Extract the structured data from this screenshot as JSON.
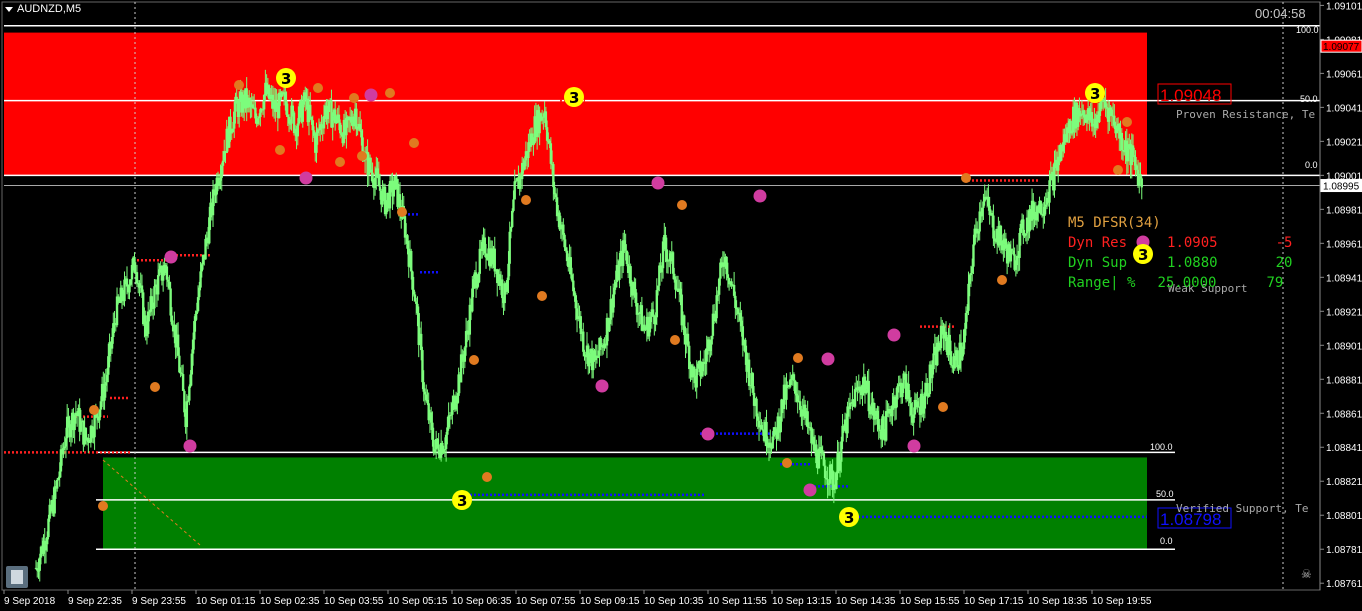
{
  "symbol": "AUDNZD,M5",
  "timer": "00:04:58",
  "colors": {
    "background": "#000000",
    "candle": "#7CFC7C",
    "resistance_zone": "#FF0000",
    "support_zone": "#008000",
    "bid_line": "#C0C0C0",
    "resistance_label": "#FF0000",
    "support_label": "#0000FF",
    "panel_title": "#E0A040",
    "panel_res": "#FF2020",
    "panel_sup": "#20D020",
    "fractal_orange": "#E07A20",
    "fractal_magenta": "#D03CA0",
    "fractal_big": "#FFFF00",
    "dot_red": "#FF2020",
    "dot_blue": "#1010FF"
  },
  "icons": [
    "calculator-icon",
    "skull-icon",
    "triangle-down-icon"
  ],
  "chart_data": {
    "type": "candlestick",
    "ylim": [
      1.08757,
      1.09103
    ],
    "y_ticks": [
      "1.09101",
      "1.09081",
      "1.09061",
      "1.09041",
      "1.09021",
      "1.09001",
      "1.08981",
      "1.08961",
      "1.08941",
      "1.08921",
      "1.08901",
      "1.08881",
      "1.08861",
      "1.08841",
      "1.08821",
      "1.08801",
      "1.08781",
      "1.08761"
    ],
    "x_ticks": [
      "9 Sep 2018",
      "9 Sep 22:35",
      "9 Sep 23:55",
      "10 Sep 01:15",
      "10 Sep 02:35",
      "10 Sep 03:55",
      "10 Sep 05:15",
      "10 Sep 06:35",
      "10 Sep 07:55",
      "10 Sep 09:15",
      "10 Sep 10:35",
      "10 Sep 11:55",
      "10 Sep 13:15",
      "10 Sep 14:35",
      "10 Sep 15:55",
      "10 Sep 17:15",
      "10 Sep 18:35",
      "10 Sep 19:55"
    ],
    "series_close": [
      1.0877,
      1.0879,
      1.08815,
      1.0885,
      1.08862,
      1.08845,
      1.08858,
      1.0888,
      1.0892,
      1.08935,
      1.0895,
      1.0891,
      1.08935,
      1.08948,
      1.08905,
      1.0886,
      1.0892,
      1.0896,
      1.08995,
      1.0902,
      1.0904,
      1.09045,
      1.09035,
      1.0905,
      1.0904,
      1.09045,
      1.0903,
      1.09045,
      1.0902,
      1.0904,
      1.09035,
      1.09025,
      1.0904,
      1.0901,
      1.09,
      1.08985,
      1.08995,
      1.0897,
      1.0893,
      1.0887,
      1.0884,
      1.08845,
      1.0887,
      1.089,
      1.0894,
      1.0896,
      1.0895,
      1.0893,
      1.0899,
      1.0901,
      1.0903,
      1.0904,
      1.0899,
      1.0896,
      1.0893,
      1.089,
      1.0889,
      1.08905,
      1.08935,
      1.0896,
      1.0893,
      1.0891,
      1.0892,
      1.0896,
      1.08945,
      1.0891,
      1.0888,
      1.0889,
      1.0892,
      1.08955,
      1.0893,
      1.089,
      1.0887,
      1.0885,
      1.08845,
      1.0887,
      1.0888,
      1.0886,
      1.0884,
      1.0883,
      1.0882,
      1.0885,
      1.0887,
      1.0888,
      1.0886,
      1.0885,
      1.0887,
      1.0888,
      1.0886,
      1.0887,
      1.0889,
      1.0891,
      1.0889,
      1.089,
      1.0896,
      1.0899,
      1.0897,
      1.0896,
      1.0895,
      1.0897,
      1.0898,
      1.08985,
      1.09,
      1.0902,
      1.09035,
      1.0904,
      1.0903,
      1.09045,
      1.09035,
      1.0902,
      1.0901,
      1.08995
    ],
    "horizontal_lines": [
      1.09089,
      1.09045,
      1.09001,
      1.08838,
      1.0881,
      1.08781
    ],
    "bid": 1.08995,
    "zones": [
      {
        "name": "Proven Resistance",
        "top": 1.09085,
        "bottom": 1.09001,
        "levels": [
          "100.0",
          "50.0",
          "0.0"
        ]
      },
      {
        "name": "Verified Support",
        "top": 1.08835,
        "bottom": 1.08781,
        "levels": [
          "100.0",
          "50.0",
          "0.0"
        ]
      }
    ],
    "price_tags": [
      {
        "label": "1.09077",
        "value": 1.09077,
        "style": "red-box"
      },
      {
        "label": "1.08995",
        "value": 1.08995,
        "style": "white-box"
      }
    ]
  },
  "zone_texts": {
    "resistance_price": "1.09048",
    "resistance_label": "Proven Resistance, Te",
    "support_price": "1.08798",
    "support_label": "Verified Support, Te",
    "weak_support": "Weak Support"
  },
  "levels_labels": {
    "l100": "100.0",
    "l50": "50.0",
    "l0": "0.0"
  },
  "fractal_big_label": "3",
  "panel": {
    "title": "M5 DFSR(34)",
    "res_label": "Dyn Res",
    "res_value": "1.0905",
    "res_diff": "-5",
    "sup_label": "Dyn Sup",
    "sup_value": "1.0880",
    "sup_diff": "20",
    "range_label": "Range| %",
    "range_value": "25.0000",
    "range_diff": "79"
  }
}
